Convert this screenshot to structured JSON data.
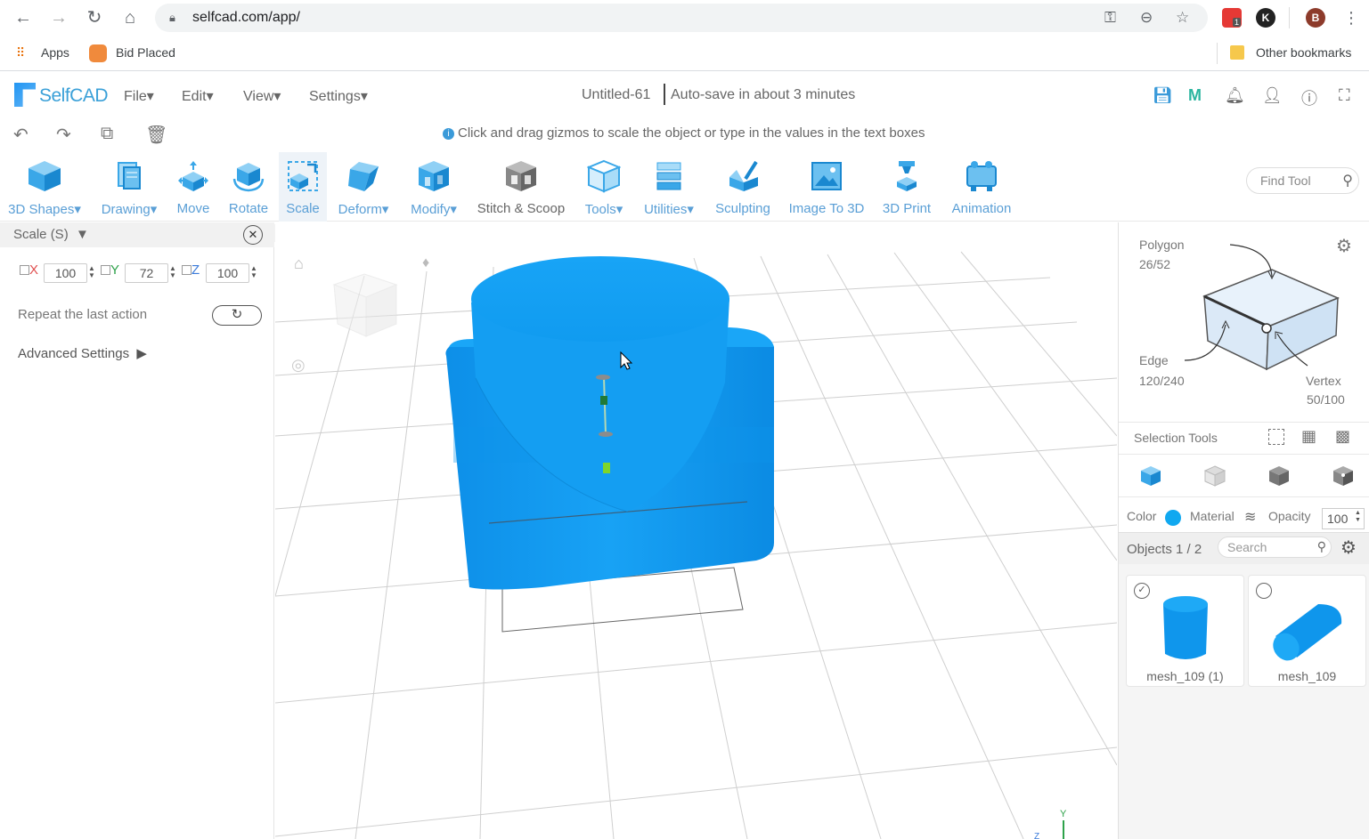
{
  "browser": {
    "url": "selfcad.com/app/",
    "bookmarks": {
      "apps": "Apps",
      "bid_placed": "Bid Placed",
      "other": "Other bookmarks"
    },
    "profile_initial": "B",
    "ext_initial": "K",
    "ext_badge": "1"
  },
  "header": {
    "logo": "SelfCAD",
    "menus": [
      "File",
      "Edit",
      "View",
      "Settings"
    ],
    "doc_title": "Untitled-61",
    "autosave": "Auto-save in about 3 minutes"
  },
  "hint": "Click and drag gizmos to scale the object or type in the values in the text boxes",
  "toolbar": {
    "tools": [
      {
        "label": "3D Shapes",
        "dropdown": true
      },
      {
        "label": "Drawing",
        "dropdown": true
      },
      {
        "label": "Move",
        "dropdown": false
      },
      {
        "label": "Rotate",
        "dropdown": false
      },
      {
        "label": "Scale",
        "dropdown": false,
        "active": true
      },
      {
        "label": "Deform",
        "dropdown": true
      },
      {
        "label": "Modify",
        "dropdown": true
      },
      {
        "label": "Stitch & Scoop",
        "dropdown": false
      },
      {
        "label": "Tools",
        "dropdown": true
      },
      {
        "label": "Utilities",
        "dropdown": true
      },
      {
        "label": "Sculpting",
        "dropdown": false
      },
      {
        "label": "Image To 3D",
        "dropdown": false
      },
      {
        "label": "3D Print",
        "dropdown": false
      },
      {
        "label": "Animation",
        "dropdown": false
      }
    ],
    "find_placeholder": "Find Tool"
  },
  "scale_panel": {
    "title": "Scale (S)",
    "x_label": "X",
    "x_value": "100",
    "y_label": "Y",
    "y_value": "72",
    "z_label": "Z",
    "z_value": "100",
    "repeat_label": "Repeat the last action",
    "advanced_label": "Advanced Settings"
  },
  "right_panel": {
    "polygon_label": "Polygon",
    "polygon_count": "26/52",
    "edge_label": "Edge",
    "edge_count": "120/240",
    "vertex_label": "Vertex",
    "vertex_count": "50/100",
    "selection_tools_label": "Selection Tools",
    "color_label": "Color",
    "material_label": "Material",
    "opacity_label": "Opacity",
    "opacity_value": "100",
    "objects_label": "Objects 1 / 2",
    "search_placeholder": "Search",
    "objects": [
      {
        "name": "mesh_109 (1)",
        "selected": true
      },
      {
        "name": "mesh_109",
        "selected": false
      }
    ]
  },
  "colors": {
    "accent": "#3a9ad9",
    "object": "#1a9cf0",
    "object_color_swatch": "#10a8f0"
  }
}
